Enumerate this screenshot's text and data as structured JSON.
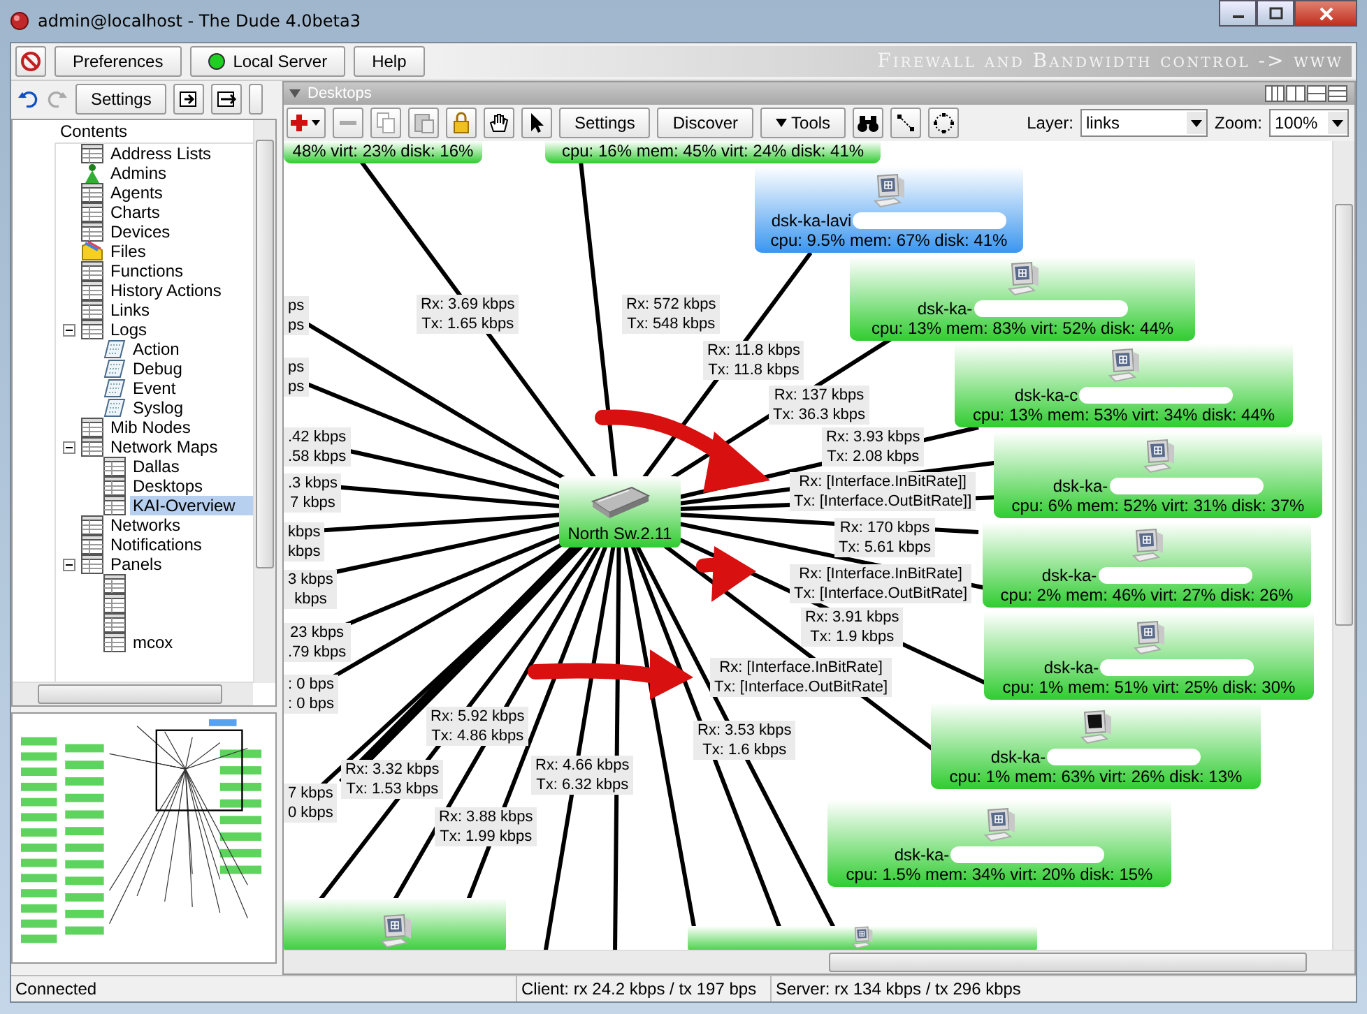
{
  "window": {
    "title": "admin@localhost - The Dude 4.0beta3"
  },
  "top_bar": {
    "buttons": [
      {
        "label": "Preferences",
        "kind": "plain"
      },
      {
        "label": "Local Server",
        "kind": "server",
        "online": true
      },
      {
        "label": "Help",
        "kind": "plain"
      }
    ],
    "banner": "Firewall and Bandwidth control -> www"
  },
  "side_toolbar": {
    "settings": "Settings"
  },
  "tree": {
    "header": "Contents",
    "items": [
      {
        "label": "Address Lists",
        "kind": "table",
        "selected": false
      },
      {
        "label": "Admins",
        "kind": "admin",
        "selected": false
      },
      {
        "label": "Agents",
        "kind": "table",
        "selected": false
      },
      {
        "label": "Charts",
        "kind": "table",
        "selected": false
      },
      {
        "label": "Devices",
        "kind": "table",
        "selected": false
      },
      {
        "label": "Files",
        "kind": "files",
        "selected": false
      },
      {
        "label": "Functions",
        "kind": "table",
        "selected": false
      },
      {
        "label": "History Actions",
        "kind": "table",
        "selected": false
      },
      {
        "label": "Links",
        "kind": "table",
        "selected": false
      },
      {
        "label": "Logs",
        "kind": "table",
        "selected": false,
        "expanded": true,
        "children": [
          {
            "label": "Action",
            "kind": "log",
            "selected": false
          },
          {
            "label": "Debug",
            "kind": "log",
            "selected": false
          },
          {
            "label": "Event",
            "kind": "log",
            "selected": false
          },
          {
            "label": "Syslog",
            "kind": "log",
            "selected": false
          }
        ]
      },
      {
        "label": "Mib Nodes",
        "kind": "table",
        "selected": false
      },
      {
        "label": "Network Maps",
        "kind": "table",
        "selected": false,
        "expanded": true,
        "children": [
          {
            "label": "Dallas",
            "kind": "table",
            "selected": false
          },
          {
            "label": "Desktops",
            "kind": "table",
            "selected": false
          },
          {
            "label": "KAI-Overview",
            "kind": "table",
            "selected": true
          }
        ]
      },
      {
        "label": "Networks",
        "kind": "table",
        "selected": false
      },
      {
        "label": "Notifications",
        "kind": "table",
        "selected": false
      },
      {
        "label": "Panels",
        "kind": "table",
        "selected": false,
        "expanded": true,
        "children": [
          {
            "kind": "table",
            "selected": false
          },
          {
            "kind": "table",
            "selected": false
          },
          {
            "kind": "table",
            "selected": false
          },
          {
            "label": "mcox",
            "kind": "table",
            "selected": false
          }
        ]
      }
    ]
  },
  "map_panel": {
    "title": "Desktops",
    "toolbar": {
      "settings": "Settings",
      "discover": "Discover",
      "tools": "Tools"
    },
    "layer": {
      "label": "Layer:",
      "value": "links"
    },
    "zoom": {
      "label": "Zoom:",
      "value": "100%"
    }
  },
  "map": {
    "switch": {
      "name": "North Sw.2.11"
    },
    "nodes": [
      {
        "stats": "48% virt: 23% disk: 16%",
        "selected": false
      },
      {
        "stats": "cpu: 16% mem: 45% virt: 24% disk: 41%",
        "selected": false
      },
      {
        "kind": "windows",
        "name": "dsk-ka-lavi",
        "stats": "cpu: 9.5% mem: 67% disk: 41%",
        "selected": true
      },
      {
        "kind": "windows",
        "name": "dsk-ka-",
        "stats": "cpu: 13% mem: 83% virt: 52% disk: 44%",
        "selected": false
      },
      {
        "kind": "windows",
        "name": "dsk-ka-c",
        "stats": "cpu: 13% mem: 53% virt: 34% disk: 44%",
        "selected": false
      },
      {
        "kind": "windows",
        "name": "dsk-ka-",
        "stats": "cpu: 6% mem: 52% virt: 31% disk: 37%",
        "selected": false
      },
      {
        "kind": "windows",
        "name": "dsk-ka-",
        "stats": "cpu: 2% mem: 46% virt: 27% disk: 26%",
        "selected": false
      },
      {
        "kind": "windows",
        "name": "dsk-ka-",
        "stats": "cpu: 1% mem: 51% virt: 25% disk: 30%",
        "selected": false
      },
      {
        "kind": "monitor",
        "name": "dsk-ka-",
        "stats": "cpu: 1% mem: 63% virt: 26% disk: 13%",
        "selected": false
      },
      {
        "kind": "windows",
        "name": "dsk-ka-",
        "stats": "cpu: 1.5% mem: 34% virt: 20% disk: 15%",
        "selected": false
      },
      {
        "kind": "windows",
        "selected": false
      },
      {
        "kind": "windows",
        "selected": false
      }
    ],
    "links": [
      {
        "rx": "ps",
        "tx": "ps"
      },
      {
        "rx": "ps",
        "tx": "ps"
      },
      {
        "rx": ".42 kbps",
        "tx": ".58 kbps"
      },
      {
        "rx": ".3 kbps",
        "tx": "7 kbps"
      },
      {
        "rx": "kbps",
        "tx": "kbps"
      },
      {
        "rx": "3 kbps",
        "tx": "kbps"
      },
      {
        "rx": "23 kbps",
        "tx": ".79 kbps"
      },
      {
        "rx": ": 0 bps",
        "tx": ": 0 bps"
      },
      {
        "rx": "7 kbps",
        "tx": "0 kbps"
      },
      {
        "rx": "Rx: 3.69 kbps",
        "tx": "Tx: 1.65 kbps"
      },
      {
        "rx": "Rx: 572 kbps",
        "tx": "Tx: 548 kbps"
      },
      {
        "rx": "Rx: 11.8 kbps",
        "tx": "Tx: 11.8 kbps"
      },
      {
        "rx": "Rx: 137 kbps",
        "tx": "Tx: 36.3 kbps"
      },
      {
        "rx": "Rx: 3.93 kbps",
        "tx": "Tx: 2.08 kbps"
      },
      {
        "rx": "Rx: [Interface.InBitRate]]",
        "tx": "Tx: [Interface.OutBitRate]]"
      },
      {
        "rx": "Rx: 170 kbps",
        "tx": "Tx: 5.61 kbps"
      },
      {
        "rx": "Rx: [Interface.InBitRate]",
        "tx": "Tx: [Interface.OutBitRate]"
      },
      {
        "rx": "Rx: 3.91 kbps",
        "tx": "Tx: 1.9 kbps"
      },
      {
        "rx": "Rx: [Interface.InBitRate]",
        "tx": "Tx: [Interface.OutBitRate]"
      },
      {
        "rx": "Rx: 3.53 kbps",
        "tx": "Tx: 1.6 kbps"
      },
      {
        "rx": "Rx: 5.92 kbps",
        "tx": "Tx: 4.86 kbps"
      },
      {
        "rx": "Rx: 3.32 kbps",
        "tx": "Tx: 1.53 kbps"
      },
      {
        "rx": "Rx: 4.66 kbps",
        "tx": "Tx: 6.32 kbps"
      },
      {
        "rx": "Rx: 3.88 kbps",
        "tx": "Tx: 1.99 kbps"
      }
    ]
  },
  "status_bar": {
    "connection": "Connected",
    "client": "Client: rx 24.2 kbps / tx 197 bps",
    "server": "Server: rx 134 kbps / tx 296 kbps"
  }
}
